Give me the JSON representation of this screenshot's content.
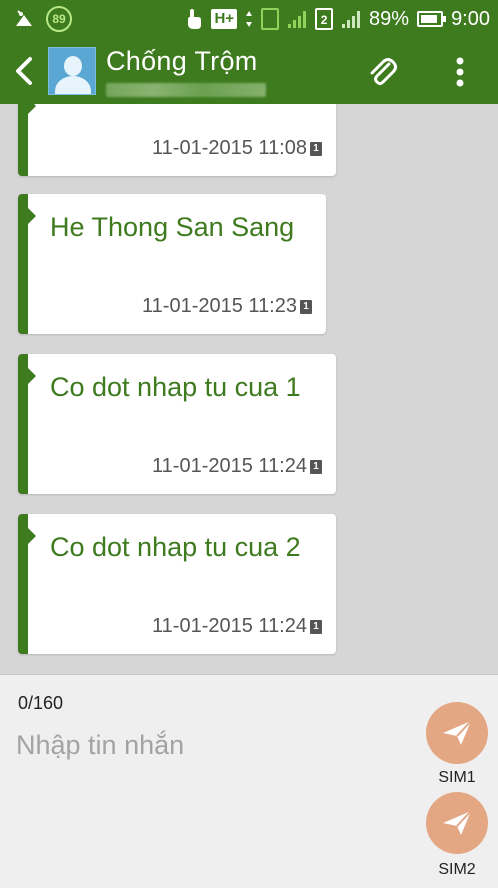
{
  "status_bar": {
    "notification_badge": "89",
    "network_type": "H+",
    "sim2_slot": "2",
    "battery_percent": "89%",
    "time": "9:00"
  },
  "app_bar": {
    "contact_name": "Chống Trộm"
  },
  "messages": [
    {
      "text": "",
      "timestamp": "11-01-2015 11:08",
      "sim": "1"
    },
    {
      "text": "He Thong San Sang",
      "timestamp": "11-01-2015 11:23",
      "sim": "1"
    },
    {
      "text": "Co dot nhap tu cua 1",
      "timestamp": "11-01-2015 11:24",
      "sim": "1"
    },
    {
      "text": "Co dot nhap tu cua 2",
      "timestamp": "11-01-2015 11:24",
      "sim": "1"
    }
  ],
  "compose": {
    "char_count": "0/160",
    "placeholder": "Nhập tin nhắn",
    "value": "",
    "sim1_label": "SIM1",
    "sim2_label": "SIM2"
  },
  "colors": {
    "primary": "#3e7a1e",
    "send_button": "#e3a784",
    "chat_background": "#d6d6d6"
  }
}
